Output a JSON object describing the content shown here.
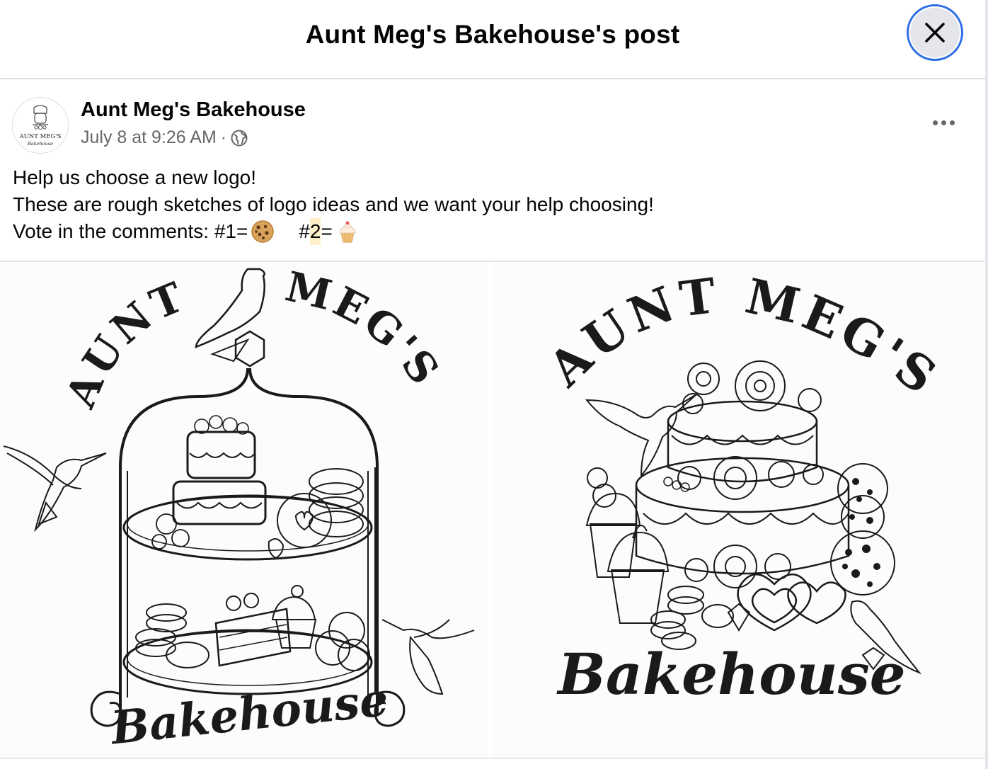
{
  "dialog": {
    "title": "Aunt Meg's Bakehouse's post"
  },
  "post": {
    "page_name": "Aunt Meg's Bakehouse",
    "timestamp": "July 8 at 9:26 AM",
    "separator": "·",
    "audience_icon": "globe-icon",
    "avatar_text_top": "AUNT MEG'S",
    "avatar_text_bottom": "Bakehouse",
    "text_line_1": "Help us choose a new logo!",
    "text_line_2": "These are rough sketches of logo ideas and we want your help choosing!",
    "text_line_3_a": "Vote in the comments: #1=",
    "text_line_3_b": "#",
    "text_line_3_highlight": "2",
    "text_line_3_c": "=",
    "emoji_1": "cookie-emoji",
    "emoji_2": "cupcake-emoji"
  },
  "photos": [
    {
      "arc_left": "AUNT",
      "arc_right": "MEG'S",
      "script": "Bakehouse"
    },
    {
      "arc": "AUNT MEG'S",
      "script": "Bakehouse"
    }
  ],
  "colors": {
    "accent_ring": "#2d6ee6",
    "secondary_text": "#65676b",
    "highlight": "#fdf0c8",
    "ink": "#1a1a1a"
  }
}
